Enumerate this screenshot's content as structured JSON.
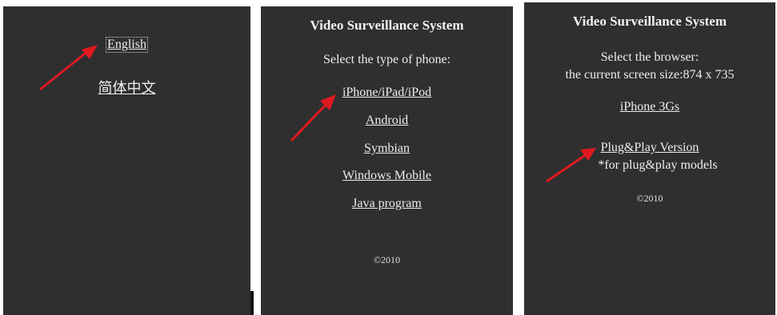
{
  "panel_language": {
    "links": [
      "English",
      "简体中文"
    ]
  },
  "panel_phone": {
    "title": "Video Surveillance System",
    "prompt": "Select the type of phone:",
    "links": [
      "iPhone/iPad/iPod",
      "Android",
      "Symbian",
      "Windows Mobile",
      "Java program"
    ],
    "copyright": "©2010"
  },
  "panel_browser": {
    "title": "Video Surveillance System",
    "prompt_line1": "Select the browser:",
    "prompt_line2": "the current screen size:874 x 735",
    "links": [
      "iPhone 3Gs",
      "Plug&Play Version"
    ],
    "note": "*for plug&play models",
    "copyright": "©2010"
  },
  "colors": {
    "panel_bg": "#2f2f2f",
    "text": "#eeeeee",
    "arrow": "#e0191f"
  },
  "icons": [
    "red-arrow-icon"
  ]
}
